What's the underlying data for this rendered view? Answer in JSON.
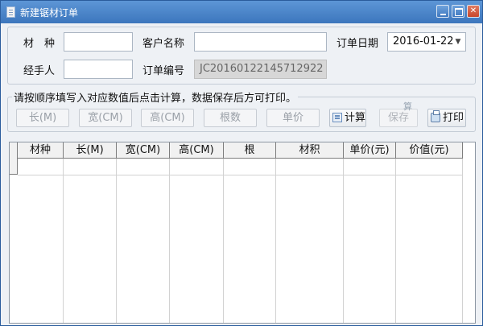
{
  "window": {
    "title": "新建锯材订单",
    "icon": "document-icon",
    "controls": [
      "minimize",
      "maximize",
      "close"
    ]
  },
  "form": {
    "material_label": "材　种",
    "material_value": "",
    "customer_label": "客户名称",
    "customer_value": "",
    "order_date_label": "订单日期",
    "order_date_value": "2016-01-22",
    "handler_label": "经手人",
    "handler_value": "",
    "order_no_label": "订单编号",
    "order_no_value": "JC20160122145712922"
  },
  "entry": {
    "legend": "请按顺序填写入对应数值后点击计算，数据保存后方可打印。",
    "inputs": [
      {
        "label": "长(M)"
      },
      {
        "label": "宽(CM)"
      },
      {
        "label": "高(CM)"
      },
      {
        "label": "根数"
      },
      {
        "label": "单价"
      }
    ],
    "calc_label": "计算",
    "save_label": "保存",
    "print_label": "打印",
    "ghost_text": "算"
  },
  "table": {
    "columns": [
      "材种",
      "长(M)",
      "宽(CM)",
      "高(CM)",
      "根",
      "材积",
      "单价(元)",
      "价值(元)"
    ],
    "rows": []
  }
}
